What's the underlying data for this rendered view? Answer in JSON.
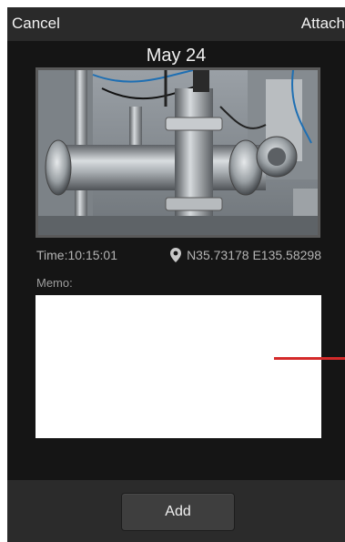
{
  "topbar": {
    "cancel_label": "Cancel",
    "attach_label": "Attach"
  },
  "entry": {
    "date": "May 24",
    "time": "Time:10:15:01",
    "latitude": "N35.73178",
    "longitude": "E135.58298",
    "location_icon": "map-pin-icon"
  },
  "memo": {
    "label": "Memo:",
    "value": ""
  },
  "bottombar": {
    "add_label": "Add"
  },
  "colors": {
    "background": "#151515",
    "bar": "#2b2b2b",
    "annotation_line": "#d42a2a"
  }
}
